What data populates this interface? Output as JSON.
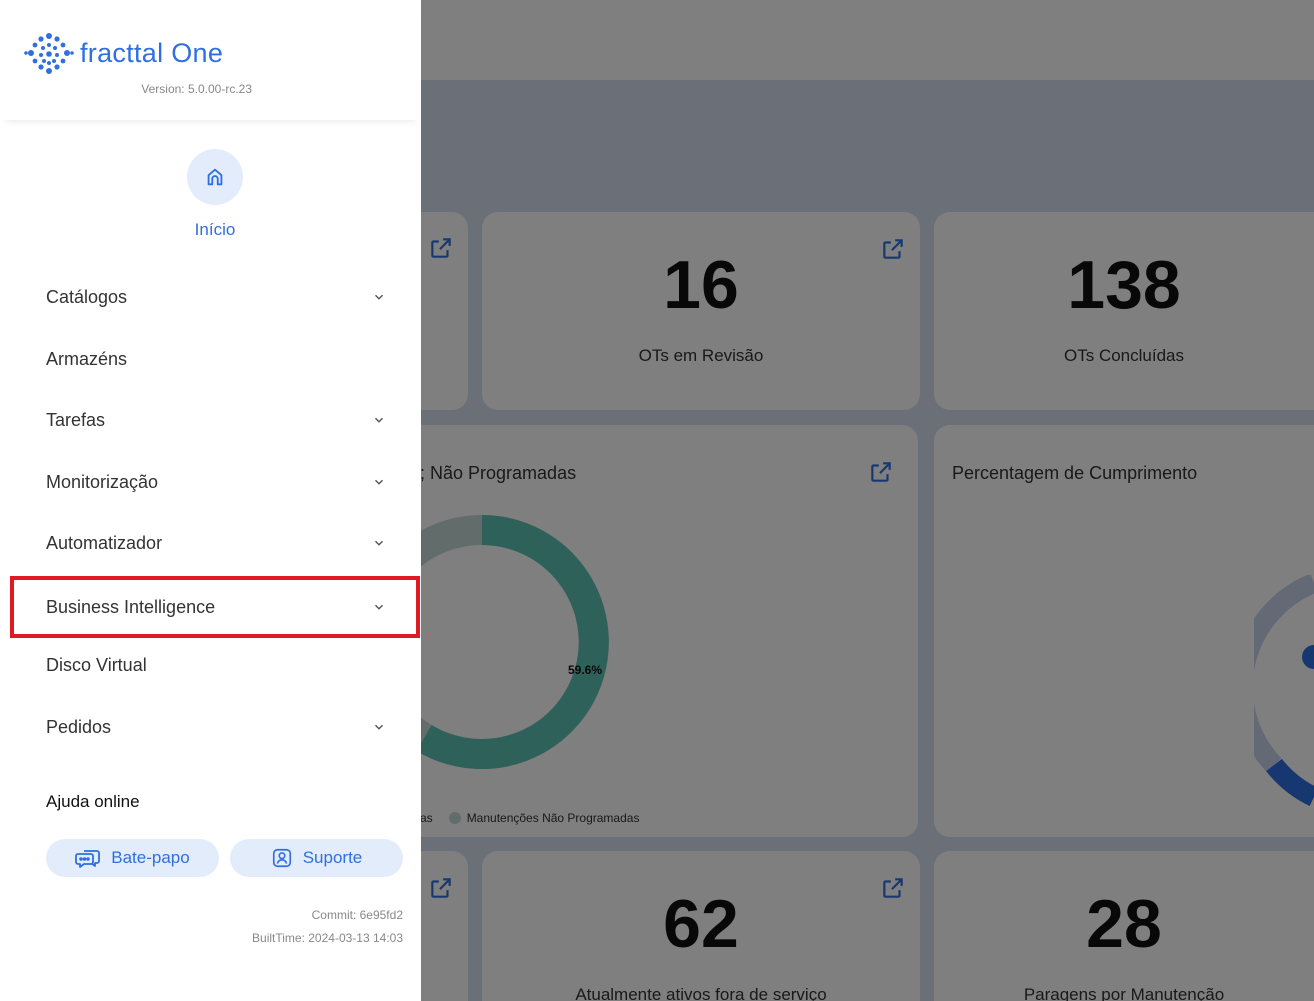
{
  "app": {
    "logo_word": "fracttal",
    "logo_suffix": "One",
    "version": "Version: 5.0.00-rc.23"
  },
  "drawer": {
    "home_label": "Início",
    "menu": [
      {
        "label": "Catálogos",
        "has_submenu": true
      },
      {
        "label": "Armazéns",
        "has_submenu": false
      },
      {
        "label": "Tarefas",
        "has_submenu": true
      },
      {
        "label": "Monitorização",
        "has_submenu": true
      },
      {
        "label": "Automatizador",
        "has_submenu": true
      },
      {
        "label": "Business Intelligence",
        "has_submenu": true,
        "highlighted": true
      },
      {
        "label": "Disco Virtual",
        "has_submenu": false
      },
      {
        "label": "Pedidos",
        "has_submenu": true
      }
    ],
    "help": {
      "title": "Ajuda online",
      "chat_label": "Bate-papo",
      "support_label": "Suporte"
    },
    "build": {
      "commit": "Commit: 6e95fd2",
      "built_time": "BuiltTime: 2024-03-13 14:03"
    }
  },
  "dashboard": {
    "kpi_ots_revisao": {
      "value": "16",
      "label": "OTs em Revisão"
    },
    "kpi_ots_concluidas": {
      "value": "138",
      "label": "OTs Concluídas"
    },
    "chart_manutencoes": {
      "title_partial": "; Não Programadas",
      "legend_left_partial": "as",
      "legend_right": "Manutenções Não Programadas",
      "percent_label": "59.6%"
    },
    "chart_cumprimento": {
      "title": "Percentagem de Cumprimento"
    },
    "kpi_fora_servico": {
      "value": "62",
      "label": "Atualmente ativos fora de serviço"
    },
    "kpi_paragens": {
      "value": "28",
      "label": "Paragens por Manutenção"
    }
  },
  "colors": {
    "accent": "#2f6fe0",
    "accent_light": "#e3ecfb",
    "highlight_border": "#e01a22",
    "donut_teal": "#5cc2b4",
    "donut_light": "#c5d8d6",
    "background_band": "#d6dfee"
  },
  "icons": {
    "home": "home-icon",
    "chevron": "chevron-down-icon",
    "chat": "chat-icon",
    "support": "support-icon",
    "external": "external-link-icon"
  }
}
